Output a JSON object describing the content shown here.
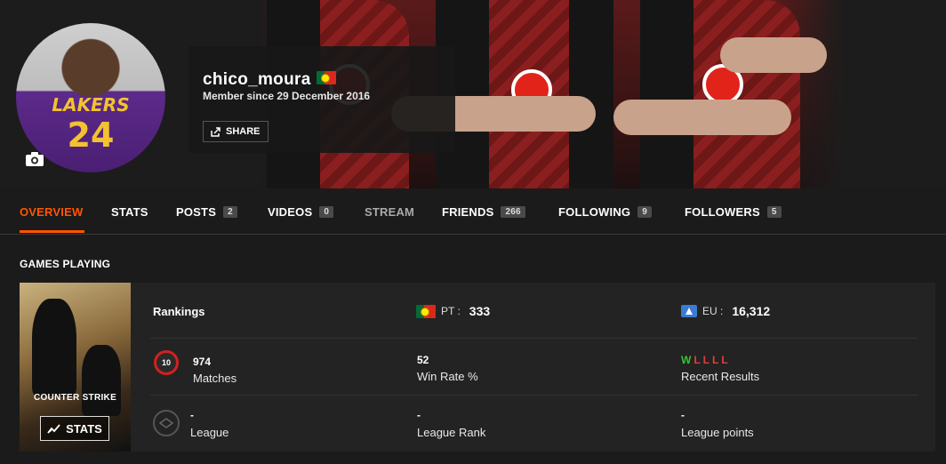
{
  "profile": {
    "username": "chico_moura",
    "member_since": "Member since 29 December 2016",
    "share_label": "SHARE",
    "avatar_jersey_brand": "LAKERS",
    "avatar_jersey_number": "24"
  },
  "tabs": [
    {
      "label": "OVERVIEW",
      "count": null,
      "state": "active"
    },
    {
      "label": "STATS",
      "count": null,
      "state": "normal"
    },
    {
      "label": "POSTS",
      "count": "2",
      "state": "normal"
    },
    {
      "label": "VIDEOS",
      "count": "0",
      "state": "normal"
    },
    {
      "label": "STREAM",
      "count": null,
      "state": "muted"
    },
    {
      "label": "FRIENDS",
      "count": "266",
      "state": "normal"
    },
    {
      "label": "FOLLOWING",
      "count": "9",
      "state": "normal"
    },
    {
      "label": "FOLLOWERS",
      "count": "5",
      "state": "normal"
    }
  ],
  "games": {
    "section_title": "GAMES PLAYING",
    "cover_title": "COUNTER STRIKE",
    "stats_button_label": "STATS",
    "rankings_label": "Rankings",
    "pt": {
      "region": "PT :",
      "value": "333"
    },
    "eu": {
      "region": "EU :",
      "value": "16,312"
    },
    "level_badge": "10",
    "matches": {
      "value": "974",
      "label": "Matches"
    },
    "win_rate": {
      "value": "52",
      "label": "Win Rate %"
    },
    "recent": {
      "results": [
        "W",
        "L",
        "L",
        "L",
        "L"
      ],
      "label": "Recent Results"
    },
    "league": {
      "value": "-",
      "label": "League"
    },
    "league_rank": {
      "value": "-",
      "label": "League Rank"
    },
    "league_points": {
      "value": "-",
      "label": "League points"
    }
  },
  "colors": {
    "accent": "#ff5500",
    "win": "#32c832",
    "loss": "#e63c3c"
  }
}
